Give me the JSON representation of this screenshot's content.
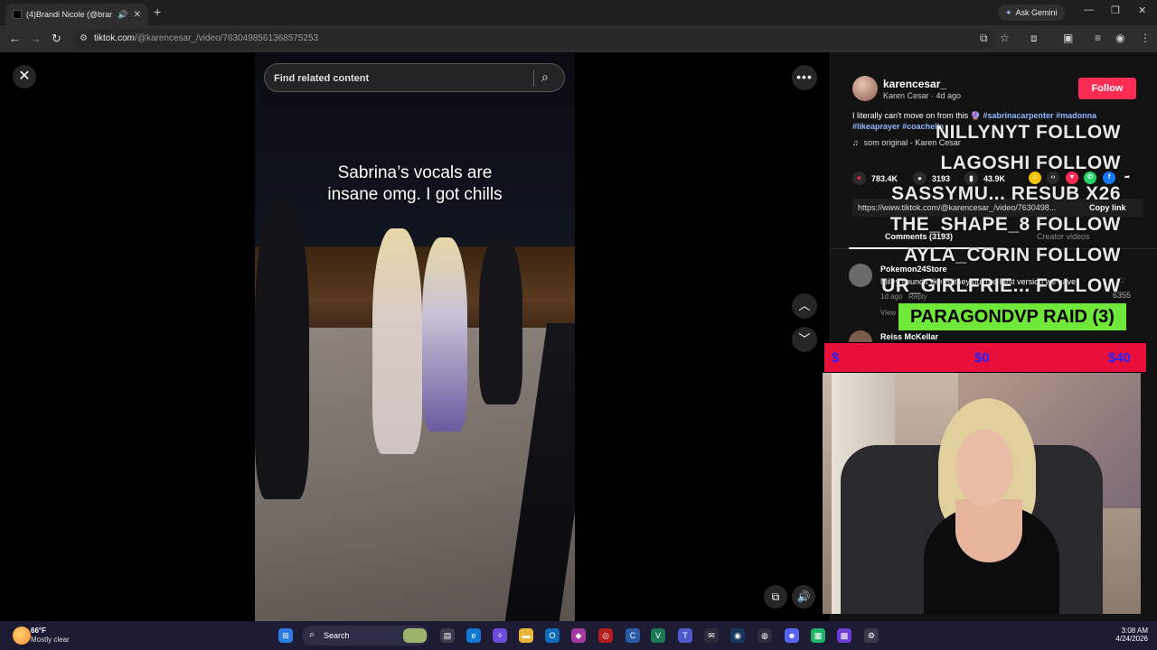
{
  "browser": {
    "tab_title": "(4)Brandi Nicole (@brandi",
    "gemini_label": "Ask Gemini",
    "url_host": "tiktok.com",
    "url_path": "/@karencesar_/video/7630498561368575253"
  },
  "video": {
    "search_placeholder": "Find related content",
    "caption_line1": "Sabrina’s vocals are",
    "caption_line2": "insane omg. I got chills"
  },
  "panel": {
    "username": "karencesar_",
    "nickname": "Karen Cesar · 4d ago",
    "follow_label": "Follow",
    "desc_text": "I literally can't move on from this",
    "desc_emoji": "🔮",
    "hashtags": [
      "#sabrinacarpenter",
      "#madonna",
      "#likeaprayer",
      "#coachella"
    ],
    "music": "som original - Karen Cesar",
    "likes": "783.4K",
    "comments_count": "3193",
    "saves": "43.9K",
    "link": "https://www.tiktok.com/@karencesar_/video/7630498...",
    "copy_label": "Copy link",
    "tab_comments": "Comments (3193)",
    "tab_creator": "Creator videos",
    "comments": [
      {
        "name": "Pokemon24Store",
        "text": "Miley sounds like Britney but the best version we have",
        "time": "1d ago",
        "reply": "Reply",
        "view": "View",
        "likes": "6355"
      },
      {
        "name": "Reiss McKellar",
        "text": "",
        "time": "",
        "reply": "",
        "view": "",
        "likes": ""
      }
    ]
  },
  "overlay": {
    "rows": [
      "NILLYNYT FOLLOW",
      "LAGOSHI FOLLOW",
      "SASSYMU... RESUB X26",
      "THE_SHAPE_8 FOLLOW",
      "AYLA_CORIN FOLLOW",
      "UR_GIRLFRIE... FOLLOW"
    ],
    "raid": "PARAGONDVP RAID (3)",
    "goal_left": "$",
    "goal_mid": "$0",
    "goal_right": "$40"
  },
  "taskbar": {
    "temp": "66°F",
    "condition": "Mostly clear",
    "search": "Search",
    "time": "3:08 AM",
    "date": "4/24/2026"
  },
  "colors": {
    "follow": "#fe2c55",
    "raid": "#6fe83a",
    "goal": "#e8103a",
    "hashtag": "#8fb8ff"
  }
}
